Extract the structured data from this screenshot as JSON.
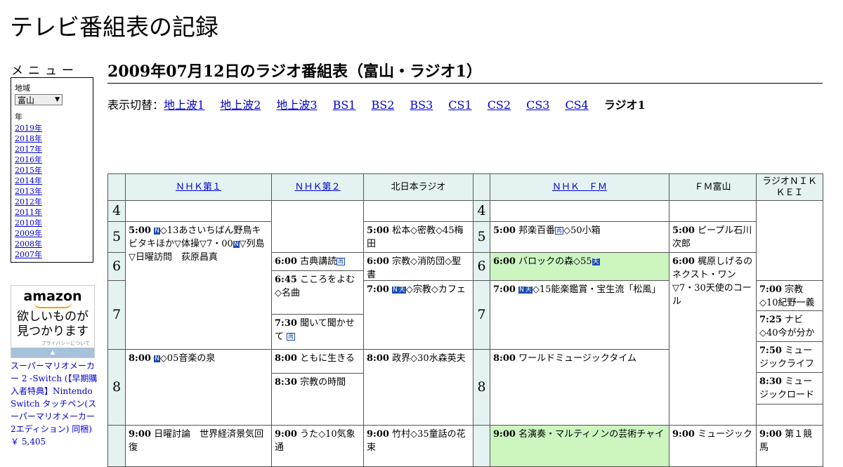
{
  "site": {
    "title": "テレビ番組表の記録"
  },
  "menu": {
    "title": "メニュー",
    "region_label": "地域",
    "region_value": "富山",
    "year_label": "年",
    "years": [
      "2019年",
      "2018年",
      "2017年",
      "2016年",
      "2015年",
      "2014年",
      "2013年",
      "2012年",
      "2011年",
      "2010年",
      "2009年",
      "2008年",
      "2007年"
    ]
  },
  "ad": {
    "logo": "amazon",
    "tagline_1": "欲しいものが",
    "tagline_2": "見つかります",
    "privacy": "プライバシーについて",
    "bar_glyph": "▲",
    "product_title": "スーパーマリオメーカー 2 -Switch (【早期購入者特典】Nintendo Switch タッチペン(スーパーマリオメーカー2エディション) 同梱)",
    "product_price": "￥ 5,405"
  },
  "page": {
    "heading": "2009年07月12日のラジオ番組表（富山・ラジオ1）"
  },
  "switcher": {
    "label": "表示切替：",
    "links": [
      "地上波1",
      "地上波2",
      "地上波3",
      "BS1",
      "BS2",
      "BS3",
      "CS1",
      "CS2",
      "CS3",
      "CS4"
    ],
    "current": "ラジオ1"
  },
  "icons": {
    "news": "N",
    "weather": "天",
    "rerun": "再"
  },
  "colors": {
    "header_bg": "#e4f2f2",
    "highlight_bg": "#ccf5c0",
    "link": "#0000cc"
  },
  "channels": [
    "ＮＨＫ第１",
    "ＮＨＫ第２",
    "北日本ラジオ",
    "ＮＨＫ　ＦＭ",
    "ＦＭ富山",
    "ラジオＮＩＫＫＥＩ"
  ],
  "hours": [
    "4",
    "5",
    "6",
    "7",
    "8",
    "4",
    "5",
    "6",
    "7",
    "8"
  ],
  "programs": {
    "p1": {
      "time": "5:00",
      "t1": "◇13あさいちばん野鳥キビタキほか▽体操▽7・00",
      "t2": "▽列島▽日曜訪問　荻原昌真"
    },
    "p2": {
      "time": "8:00",
      "title": "◇05音楽の泉"
    },
    "p3": {
      "time": "9:00",
      "title": "日曜討論　世界経済景気回復"
    },
    "p4": {
      "time": "6:00",
      "title": "古典講読"
    },
    "p5": {
      "time": "6:45",
      "title": "こころをよむ◇名曲"
    },
    "p6": {
      "time": "7:30",
      "title": "聞いて聞かせて"
    },
    "p7": {
      "time": "8:00",
      "title": "ともに生きる"
    },
    "p8": {
      "time": "8:30",
      "title": "宗教の時間"
    },
    "p9": {
      "time": "9:00",
      "title": "うた◇10気象通"
    },
    "p10": {
      "time": "5:00",
      "title": "松本◇密教◇45梅田"
    },
    "p11": {
      "time": "6:00",
      "title": "宗教◇消防団◇聖書"
    },
    "p12": {
      "time": "7:00",
      "title": "◇宗教◇カフェ"
    },
    "p13": {
      "time": "8:00",
      "title": "政界◇30水森英夫"
    },
    "p14": {
      "time": "9:00",
      "title": "竹村◇35童話の花束"
    },
    "p15": {
      "time": "5:00",
      "t1": "邦楽百番",
      "t2": "◇50小箱"
    },
    "p16": {
      "time": "6:00",
      "title": "バロックの森◇55"
    },
    "p17": {
      "time": "7:00",
      "title": "◇15能楽鑑賞・宝生流「松風」"
    },
    "p18": {
      "time": "8:00",
      "title": "ワールドミュージックタイム"
    },
    "p19": {
      "time": "9:00",
      "title": "名演奏・マルティノンの芸術チャイ"
    },
    "p20": {
      "time": "5:00",
      "title": "ピープル石川次郎"
    },
    "p21": {
      "time": "6:00",
      "title": "梶原しげるのネクスト・ワン▽7・30天使のコール"
    },
    "p22": {
      "time": "9:00",
      "title": "ミュージック"
    },
    "p23": {
      "time": "7:00",
      "title": "宗教◇10紀野一義"
    },
    "p24": {
      "time": "7:25",
      "title": "ナビ◇40今が分かる"
    },
    "p25": {
      "time": "7:50",
      "title": "ミュージックライフ"
    },
    "p26": {
      "time": "8:30",
      "title": "ミュージックロード"
    },
    "p27": {
      "time": "9:00",
      "title": "第１競馬"
    }
  }
}
